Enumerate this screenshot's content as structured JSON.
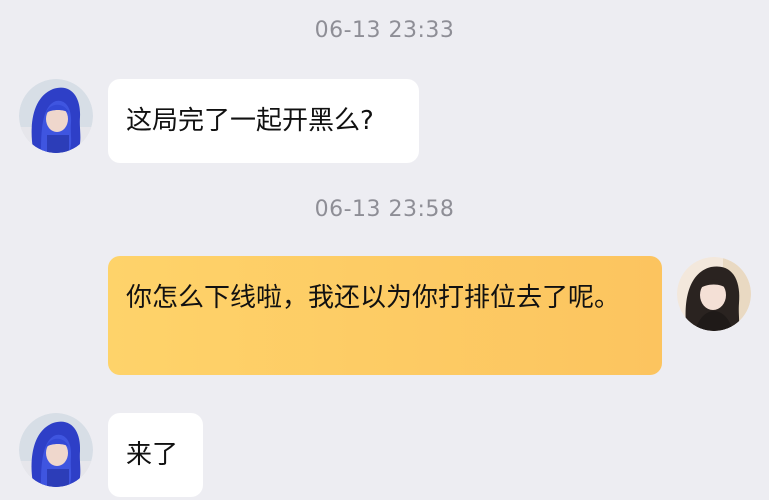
{
  "chat": {
    "timestamps": [
      "06-13 23:33",
      "06-13 23:58"
    ],
    "messages": [
      {
        "sender": "left",
        "text": "这局完了一起开黑么?"
      },
      {
        "sender": "right",
        "text": "你怎么下线啦，我还以为你打排位去了呢。"
      },
      {
        "sender": "left",
        "text": "来了"
      }
    ]
  },
  "colors": {
    "background": "#EDEDF2",
    "incoming_bubble": "#FFFFFF",
    "outgoing_bubble": "#FCC45F",
    "timestamp_text": "#8E8E96"
  },
  "icons": {
    "left_avatar": "blue-haired-avatar",
    "right_avatar": "dark-haired-avatar"
  }
}
